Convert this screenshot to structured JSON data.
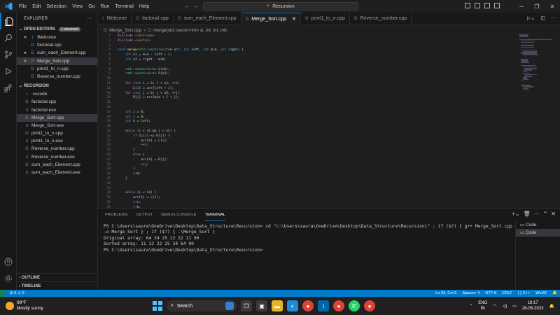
{
  "titlebar": {
    "menu": [
      "File",
      "Edit",
      "Selection",
      "View",
      "Go",
      "Run",
      "Terminal",
      "Help"
    ],
    "search": "Recursion"
  },
  "sidebar": {
    "title": "EXPLORER",
    "open_editors_label": "OPEN EDITORS",
    "unsaved_badge": "1 unsaved",
    "open_editors": [
      {
        "label": "Welcome",
        "lead": "✕",
        "icon": "vscode-icon",
        "italic": true
      },
      {
        "label": "factorial.cpp",
        "lead": "",
        "icon": "cpp-file-icon"
      },
      {
        "label": "sum_each_Element.cpp",
        "lead": "●",
        "icon": "cpp-file-icon"
      },
      {
        "label": "Merge_Sort.cpp",
        "lead": "✕",
        "icon": "cpp-file-icon",
        "selected": true
      },
      {
        "label": "print1_to_n.cpp",
        "lead": "",
        "icon": "cpp-file-icon"
      },
      {
        "label": "Reverse_number.cpp",
        "lead": "",
        "icon": "cpp-file-icon"
      }
    ],
    "folder_label": "RECURSION",
    "files": [
      {
        "label": ".vscode",
        "icon": "chevron-right-icon"
      },
      {
        "label": "factorial.cpp",
        "icon": "cpp-file-icon"
      },
      {
        "label": "factorial.exe",
        "icon": "exe-file-icon"
      },
      {
        "label": "Merge_Sort.cpp",
        "icon": "cpp-file-icon",
        "selected": true
      },
      {
        "label": "Merge_Sort.exe",
        "icon": "exe-file-icon"
      },
      {
        "label": "print1_to_n.cpp",
        "icon": "cpp-file-icon"
      },
      {
        "label": "print1_to_n.exe",
        "icon": "exe-file-icon"
      },
      {
        "label": "Reverse_number.cpp",
        "icon": "cpp-file-icon"
      },
      {
        "label": "Reverse_number.exe",
        "icon": "exe-file-icon"
      },
      {
        "label": "sum_each_Element.cpp",
        "icon": "cpp-file-icon"
      },
      {
        "label": "sum_each_Element.exe",
        "icon": "exe-file-icon"
      }
    ],
    "outline_label": "OUTLINE",
    "timeline_label": "TIMELINE"
  },
  "tabs": [
    {
      "label": "Welcome",
      "icon": "vscode-icon",
      "active": false
    },
    {
      "label": "factorial.cpp",
      "icon": "cpp-file-icon",
      "active": false
    },
    {
      "label": "sum_each_Element.cpp",
      "icon": "cpp-file-icon",
      "active": false
    },
    {
      "label": "Merge_Sort.cpp",
      "icon": "cpp-file-icon",
      "active": true
    },
    {
      "label": "print1_to_n.cpp",
      "icon": "cpp-file-icon",
      "active": false
    },
    {
      "label": "Reverse_number.cpp",
      "icon": "cpp-file-icon",
      "active": false
    }
  ],
  "breadcrumb": {
    "file": "Merge_Sort.cpp",
    "symbol": "merge(std::vector<int> &, int, int, int)"
  },
  "code_lines": [
    "#include <iostream>",
    "#include <vector>",
    "",
    "void merge(std::vector<int>& arr, int left, int mid, int right) {",
    "    int n1 = mid - left + 1;",
    "    int n2 = right - mid;",
    "",
    "    std::vector<int> L(n1);",
    "    std::vector<int> R(n2);",
    "",
    "    for (int i = 0; i < n1; ++i)",
    "        L[i] = arr[left + i];",
    "    for (int j = 0; j < n2; ++j)",
    "        R[j] = arr[mid + 1 + j];",
    "",
    "",
    "    int i = 0;",
    "    int j = 0;",
    "    int k = left;",
    "",
    "    while (i < n1 && j < n2) {",
    "        if (L[i] <= R[j]) {",
    "            arr[k] = L[i];",
    "            ++i;",
    "        }",
    "        else {",
    "            arr[k] = R[j];",
    "            ++j;",
    "        }",
    "        ++k;",
    "    }",
    "",
    "",
    "    while (i < n1) {",
    "        arr[k] = L[i];",
    "        ++i;",
    "        ++k;"
  ],
  "panel": {
    "tabs": [
      "PROBLEMS",
      "OUTPUT",
      "DEBUG CONSOLE",
      "TERMINAL"
    ],
    "active_tab": "TERMINAL",
    "terminal_lines": [
      "PS C:\\Users\\saura\\OneDrive\\Desktop\\Data_Structure\\Recursion> cd \"c:\\Users\\saura\\OneDrive\\Desktop\\Data_Structure\\Recursion\\\" ; if ($?) { g++ Merge_Sort.cpp -o Merge_Sort } ; if ($?) { .\\Merge_Sort }",
      "Original array: 64 34 25 12 22 11 90",
      "Sorted array: 11 12 22 25 34 64 90",
      "PS C:\\Users\\saura\\OneDrive\\Desktop\\Data_Structure\\Recursion>"
    ],
    "terminals": [
      "Code",
      "Code"
    ]
  },
  "statusbar": {
    "errors": "0",
    "warnings": "0",
    "position": "Ln 33, Col 5",
    "spaces": "Spaces: 4",
    "encoding": "UTF-8",
    "eol": "CRLF",
    "language": "C++",
    "platform": "Win32"
  },
  "taskbar": {
    "temperature": "99°F",
    "weather": "Mostly sunny",
    "search": "Search",
    "lang1": "ENG",
    "lang2": "IN",
    "time": "18:17",
    "date": "28-05-2023"
  },
  "colors": {
    "accent": "#0078d4",
    "statusbar": "#007acc",
    "keyword": "#c586c0",
    "type": "#569cd6",
    "function": "#dcdcaa",
    "variable": "#9cdcfe",
    "number": "#b5cea8"
  }
}
